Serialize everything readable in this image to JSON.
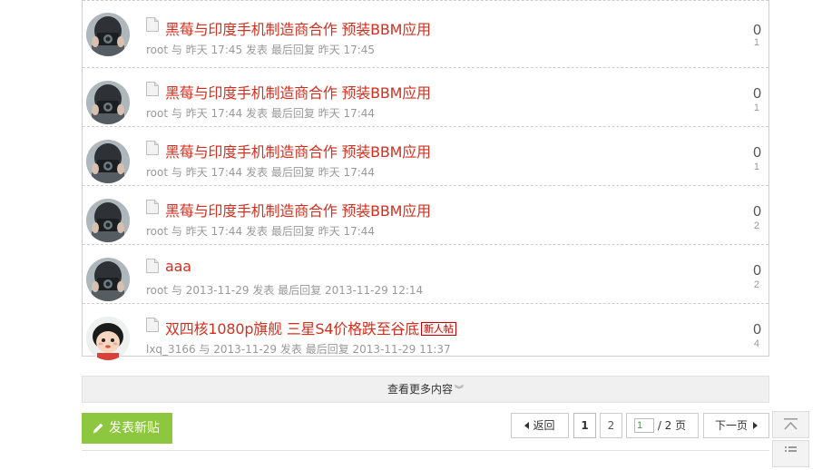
{
  "threads": [
    {
      "title": "黑莓与印度手机制造商合作 预装BBM应用",
      "user": "root",
      "sep1": "与",
      "date1": "昨天 17:45",
      "posted": "发表",
      "last_reply": "最后回复",
      "date2": "昨天 17:45",
      "replies": "0",
      "views": "1",
      "avatar": "camera-girl"
    },
    {
      "title": "黑莓与印度手机制造商合作 预装BBM应用",
      "user": "root",
      "sep1": "与",
      "date1": "昨天 17:44",
      "posted": "发表",
      "last_reply": "最后回复",
      "date2": "昨天 17:44",
      "replies": "0",
      "views": "1",
      "avatar": "camera-girl"
    },
    {
      "title": "黑莓与印度手机制造商合作 预装BBM应用",
      "user": "root",
      "sep1": "与",
      "date1": "昨天 17:44",
      "posted": "发表",
      "last_reply": "最后回复",
      "date2": "昨天 17:44",
      "replies": "0",
      "views": "1",
      "avatar": "camera-girl"
    },
    {
      "title": "黑莓与印度手机制造商合作 预装BBM应用",
      "user": "root",
      "sep1": "与",
      "date1": "昨天 17:44",
      "posted": "发表",
      "last_reply": "最后回复",
      "date2": "昨天 17:44",
      "replies": "0",
      "views": "2",
      "avatar": "camera-girl"
    },
    {
      "title": "aaa",
      "user": "root",
      "sep1": "与",
      "date1": "2013-11-29",
      "posted": "发表",
      "last_reply": "最后回复",
      "date2": "2013-11-29 12:14",
      "replies": "0",
      "views": "2",
      "avatar": "camera-girl"
    },
    {
      "title": "双四核1080p旗舰 三星S4价格跌至谷底",
      "badge": "新人帖",
      "user": "lxq_3166",
      "sep1": "与",
      "date1": "2013-11-29",
      "posted": "发表",
      "last_reply": "最后回复",
      "date2": "2013-11-29 11:37",
      "replies": "0",
      "views": "4",
      "avatar": "cartoon-kid"
    }
  ],
  "more": {
    "label": "查看更多内容",
    "icon": "double-chevron-down-icon"
  },
  "post_button": {
    "label": "发表新贴",
    "icon": "pencil-icon"
  },
  "pagination": {
    "prev_label": "返回",
    "pages": [
      "1",
      "2"
    ],
    "current": "1",
    "jump_value": "1",
    "total_text": "/ 2 页",
    "next_label": "下一页"
  },
  "colors": {
    "title_red": "#d32f1f",
    "post_green": "#8dc63f",
    "meta_gray": "#999999"
  }
}
